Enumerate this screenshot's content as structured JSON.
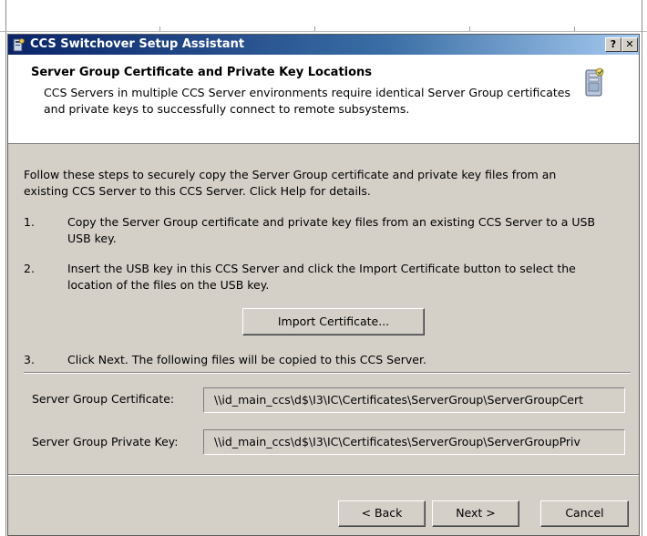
{
  "window": {
    "title": "CCS Switchover Setup Assistant",
    "help_glyph": "?",
    "close_glyph": "✕"
  },
  "header": {
    "title": "Server Group Certificate and Private Key Locations",
    "description": "CCS Servers in multiple CCS Server environments require identical Server Group certificates and private keys to successfully connect to remote subsystems.",
    "icon": "server-wizard-icon"
  },
  "content": {
    "intro": "Follow these steps to securely copy the Server Group certificate and private key files from an existing CCS Server to this CCS Server. Click Help for details.",
    "steps": [
      {
        "num": "1.",
        "line1": "Copy the Server Group certificate and private key files from an existing CCS Server to a USB",
        "line2": "USB key."
      },
      {
        "num": "2.",
        "line1": "Insert the USB key in this CCS Server and click the Import Certificate button to select the",
        "line2": "location of the files on the USB key."
      },
      {
        "num": "3.",
        "line1": "Click Next. The following files will be copied to this CCS Server."
      }
    ],
    "import_button": "Import Certificate...",
    "cert_label": "Server Group Certificate:",
    "cert_value": "\\\\id_main_ccs\\d$\\I3\\IC\\Certificates\\ServerGroup\\ServerGroupCert",
    "key_label": "Server Group Private Key:",
    "key_value": "\\\\id_main_ccs\\d$\\I3\\IC\\Certificates\\ServerGroup\\ServerGroupPriv"
  },
  "footer": {
    "back": "< Back",
    "next": "Next >",
    "cancel": "Cancel"
  }
}
